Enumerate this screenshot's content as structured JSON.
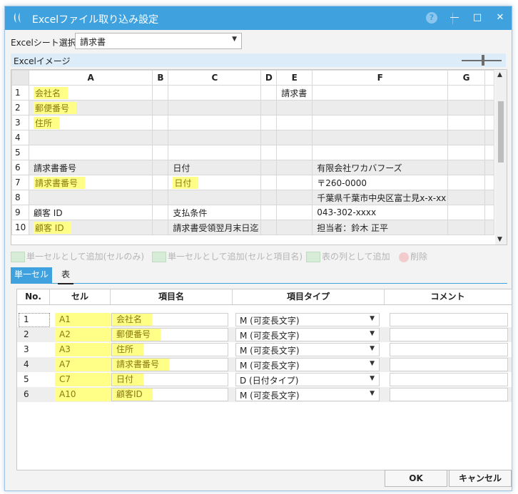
{
  "window": {
    "title": "Excelファイル取り込み設定",
    "help": "?",
    "minimize": "—",
    "maximize": "□",
    "close": "✕"
  },
  "sheet_select": {
    "label": "Excelシート選択",
    "value": "請求書"
  },
  "image_section": {
    "label": "Excelイメージ"
  },
  "grid": {
    "columns": [
      "A",
      "B",
      "C",
      "D",
      "E",
      "F",
      "G"
    ],
    "rows": [
      {
        "n": "1",
        "A": "会社名",
        "C": "",
        "E": "請求書",
        "F": ""
      },
      {
        "n": "2",
        "A": "郵便番号",
        "C": "",
        "E": "",
        "F": ""
      },
      {
        "n": "3",
        "A": "住所",
        "C": "",
        "E": "",
        "F": ""
      },
      {
        "n": "4",
        "A": "",
        "C": "",
        "E": "",
        "F": ""
      },
      {
        "n": "5",
        "A": "",
        "C": "",
        "E": "",
        "F": ""
      },
      {
        "n": "6",
        "A": "請求書番号",
        "C": "日付",
        "E": "",
        "F": "有限会社ワカバフーズ"
      },
      {
        "n": "7",
        "A": "請求書番号",
        "C": "日付",
        "E": "",
        "F": "〒260-0000"
      },
      {
        "n": "8",
        "A": "",
        "C": "",
        "E": "",
        "F": "千葉県千葉市中央区富士見x-x-xx"
      },
      {
        "n": "9",
        "A": "顧客 ID",
        "C": "支払条件",
        "E": "",
        "F": "043-302-xxxx"
      },
      {
        "n": "10",
        "A": "顧客 ID",
        "C": "請求書受領翌月末日迄",
        "E": "",
        "F": "担当者：鈴木 正平"
      }
    ]
  },
  "toolbar": {
    "add_single_cell": "単一セルとして追加(セルのみ)",
    "add_single_cell_with_name": "単一セルとして追加(セルと項目名)",
    "add_table_column": "表の列として追加",
    "delete": "削除"
  },
  "tabs": {
    "active": "単一セル",
    "other": "表"
  },
  "list": {
    "headers": {
      "no": "No.",
      "cell": "セル",
      "item_name": "項目名",
      "item_type": "項目タイプ",
      "comment": "コメント"
    },
    "rows": [
      {
        "no": "1",
        "cell": "A1",
        "item_name": "会社名",
        "item_type": "M (可変長文字)",
        "comment": ""
      },
      {
        "no": "2",
        "cell": "A2",
        "item_name": "郵便番号",
        "item_type": "M (可変長文字)",
        "comment": ""
      },
      {
        "no": "3",
        "cell": "A3",
        "item_name": "住所",
        "item_type": "M (可変長文字)",
        "comment": ""
      },
      {
        "no": "4",
        "cell": "A7",
        "item_name": "請求書番号",
        "item_type": "M (可変長文字)",
        "comment": ""
      },
      {
        "no": "5",
        "cell": "C7",
        "item_name": "日付",
        "item_type": "D (日付タイプ)",
        "comment": ""
      },
      {
        "no": "6",
        "cell": "A10",
        "item_name": "顧客ID",
        "item_type": "M (可変長文字)",
        "comment": ""
      }
    ]
  },
  "buttons": {
    "ok": "OK",
    "cancel": "キャンセル"
  },
  "colors": {
    "titlebar": "#3fa2df",
    "highlight": "#ffff88",
    "image_bar": "#dcecf8"
  }
}
